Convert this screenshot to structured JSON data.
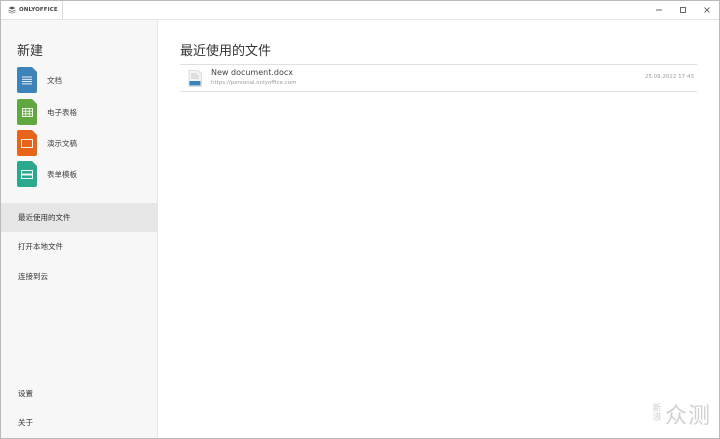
{
  "titlebar": {
    "app_name": "ONLYOFFICE"
  },
  "sidebar": {
    "create_title": "新建",
    "create_items": [
      {
        "label": "文档",
        "icon": "document-icon",
        "color": "#3c83b9"
      },
      {
        "label": "电子表格",
        "icon": "spreadsheet-icon",
        "color": "#5fa73e"
      },
      {
        "label": "演示文稿",
        "icon": "presentation-icon",
        "color": "#e8641a"
      },
      {
        "label": "表单模板",
        "icon": "form-template-icon",
        "color": "#2aa98e"
      }
    ],
    "nav_items": [
      {
        "label": "最近使用的文件",
        "active": true
      },
      {
        "label": "打开本地文件"
      },
      {
        "label": "连接到云"
      }
    ],
    "bottom_items": [
      {
        "label": "设置"
      },
      {
        "label": "关于"
      }
    ]
  },
  "main": {
    "title": "最近使用的文件",
    "files": [
      {
        "name": "New document.docx",
        "path": "https://personal.onlyoffice.com",
        "date": "25.09.2022 17:43",
        "icon": "docx-file-icon"
      }
    ]
  },
  "watermark": {
    "small": "新浪",
    "big": "众测"
  }
}
